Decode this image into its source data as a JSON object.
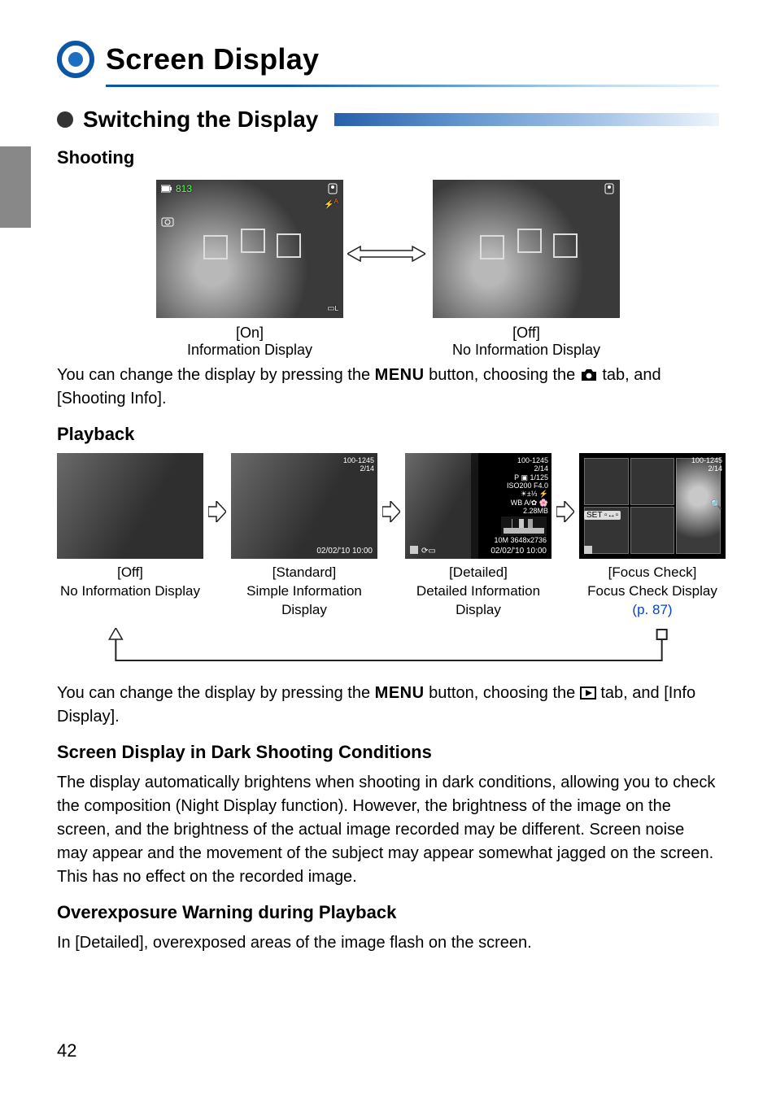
{
  "page_number": "42",
  "title": "Screen Display",
  "section": "Switching the Display",
  "subheads": {
    "shooting": "Shooting",
    "playback": "Playback",
    "dark": "Screen Display in Dark Shooting Conditions",
    "overexp": "Overexposure Warning during Playback"
  },
  "shooting_modes": {
    "on": {
      "label": "[On]",
      "desc": "Information Display"
    },
    "off": {
      "label": "[Off]",
      "desc": "No Information Display"
    },
    "hud": {
      "battery_shots": "813"
    }
  },
  "body": {
    "shooting_para_pre": "You can change the display by pressing the ",
    "menu_word": "MENU",
    "shooting_para_post": " button, choosing the ",
    "shooting_para_end": " tab, and [Shooting Info].",
    "playback_para_pre": "You can change the display by pressing the ",
    "playback_para_post": " button, choosing the ",
    "playback_para_end": " tab, and [Info Display].",
    "dark_para": "The display automatically brightens when shooting in dark conditions, allowing you to check the composition (Night Display function). However, the brightness of the image on the screen, and the brightness of the actual image recorded may be different. Screen noise may appear and the movement of the subject may appear somewhat jagged on the screen. This has no effect on the recorded image.",
    "overexp_para": "In [Detailed], overexposed areas of the image flash on the screen."
  },
  "playback_modes": [
    {
      "label": "[Off]",
      "desc": "No Information Display"
    },
    {
      "label": "[Standard]",
      "desc": "Simple Information Display"
    },
    {
      "label": "[Detailed]",
      "desc": "Detailed Information Display"
    },
    {
      "label": "[Focus Check]",
      "desc": "Focus Check Display",
      "link": "(p. 87)"
    }
  ],
  "preview_overlays": {
    "standard": {
      "counter": "100-1245",
      "index": "2/14",
      "date": "02/02/'10    10:00"
    },
    "detailed": {
      "counter": "100-1245",
      "index": "2/14",
      "lines": [
        "P  ▣   1/125",
        "ISO200   F4.0",
        "☀±⅓  ⚡",
        "WB A/✿   🌸",
        "2.28MB"
      ],
      "res": "10M 3648x2736",
      "date": "02/02/'10    10:00"
    },
    "focus": {
      "counter": "100-1245",
      "index": "2/14",
      "set": "SET"
    }
  }
}
